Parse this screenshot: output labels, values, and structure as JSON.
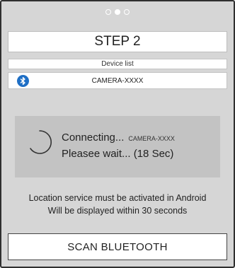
{
  "pager": {
    "total": 3,
    "active_index": 1
  },
  "step": {
    "title": "STEP 2"
  },
  "device_list": {
    "header": "Device list",
    "items": [
      {
        "icon": "bluetooth-icon",
        "name": "CAMERA-XXXX"
      }
    ]
  },
  "connecting": {
    "status": "Connecting...",
    "device": "CAMERA-XXXX",
    "wait_text": "Pleasee wait... (18 Sec)"
  },
  "notice": {
    "line1": "Location service must be activated in Android",
    "line2": "Will be displayed within 30 seconds"
  },
  "scan_button": {
    "label": "SCAN BLUETOOTH"
  },
  "colors": {
    "background": "#d6d6d6",
    "panel": "#c3c3c3",
    "bluetooth_blue": "#1f6fc5"
  }
}
